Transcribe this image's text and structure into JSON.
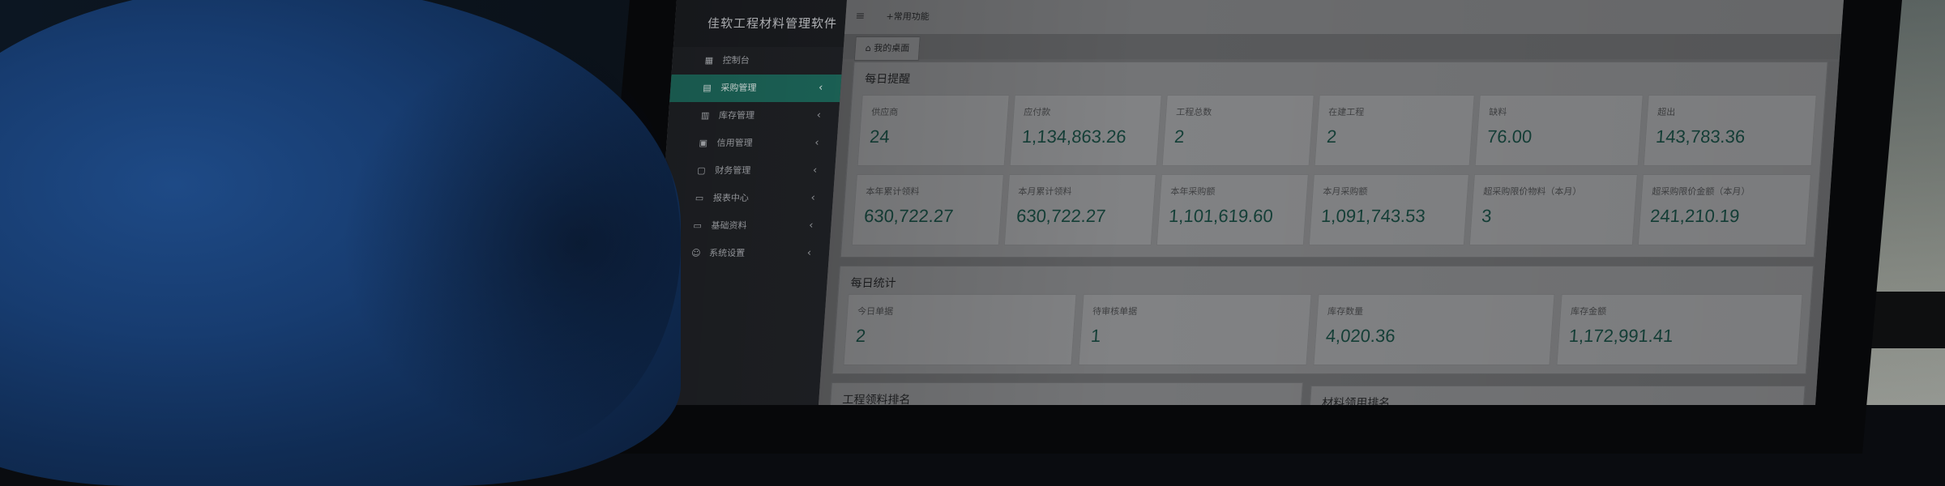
{
  "app": {
    "title": "佳软工程材料管理软件"
  },
  "topbar": {
    "menu_icon": "hamburger-icon",
    "common_functions": "+常用功能"
  },
  "tabs": [
    {
      "label": "我的桌面",
      "icon": "home-icon",
      "active": true
    }
  ],
  "sidebar": {
    "items": [
      {
        "label": "控制台",
        "icon": "dashboard-icon",
        "active": false,
        "has_children": false
      },
      {
        "label": "采购管理",
        "icon": "purchase-icon",
        "active": true,
        "has_children": true
      },
      {
        "label": "库存管理",
        "icon": "inventory-icon",
        "active": false,
        "has_children": true
      },
      {
        "label": "信用管理",
        "icon": "credit-icon",
        "active": false,
        "has_children": true
      },
      {
        "label": "财务管理",
        "icon": "finance-icon",
        "active": false,
        "has_children": true
      },
      {
        "label": "报表中心",
        "icon": "report-folder-icon",
        "active": false,
        "has_children": true
      },
      {
        "label": "基础资料",
        "icon": "folder-icon",
        "active": false,
        "has_children": true
      },
      {
        "label": "系统设置",
        "icon": "user-settings-icon",
        "active": false,
        "has_children": true
      }
    ]
  },
  "daily_reminder": {
    "title": "每日提醒",
    "row1": [
      {
        "label": "供应商",
        "value": "24"
      },
      {
        "label": "应付款",
        "value": "1,134,863.26"
      },
      {
        "label": "工程总数",
        "value": "2"
      },
      {
        "label": "在建工程",
        "value": "2"
      },
      {
        "label": "缺料",
        "value": "76.00"
      },
      {
        "label": "超出",
        "value": "143,783.36"
      }
    ],
    "row2": [
      {
        "label": "本年累计领料",
        "value": "630,722.27"
      },
      {
        "label": "本月累计领料",
        "value": "630,722.27"
      },
      {
        "label": "本年采购额",
        "value": "1,101,619.60"
      },
      {
        "label": "本月采购额",
        "value": "1,091,743.53"
      },
      {
        "label": "超采购限价物料（本月）",
        "value": "3"
      },
      {
        "label": "超采购限价金额（本月）",
        "value": "241,210.19"
      }
    ]
  },
  "daily_stats": {
    "title": "每日统计",
    "items": [
      {
        "label": "今日单据",
        "value": "2"
      },
      {
        "label": "待审核单据",
        "value": "1"
      },
      {
        "label": "库存数量",
        "value": "4,020.36"
      },
      {
        "label": "库存金额",
        "value": "1,172,991.41"
      }
    ]
  },
  "bottom_panels": {
    "project_ranking": "工程领料排名",
    "material_ranking": "材料领用排名"
  },
  "colors": {
    "accent": "#1e6b5e",
    "value_text": "#143f37",
    "sidebar_bg": "#202226"
  }
}
